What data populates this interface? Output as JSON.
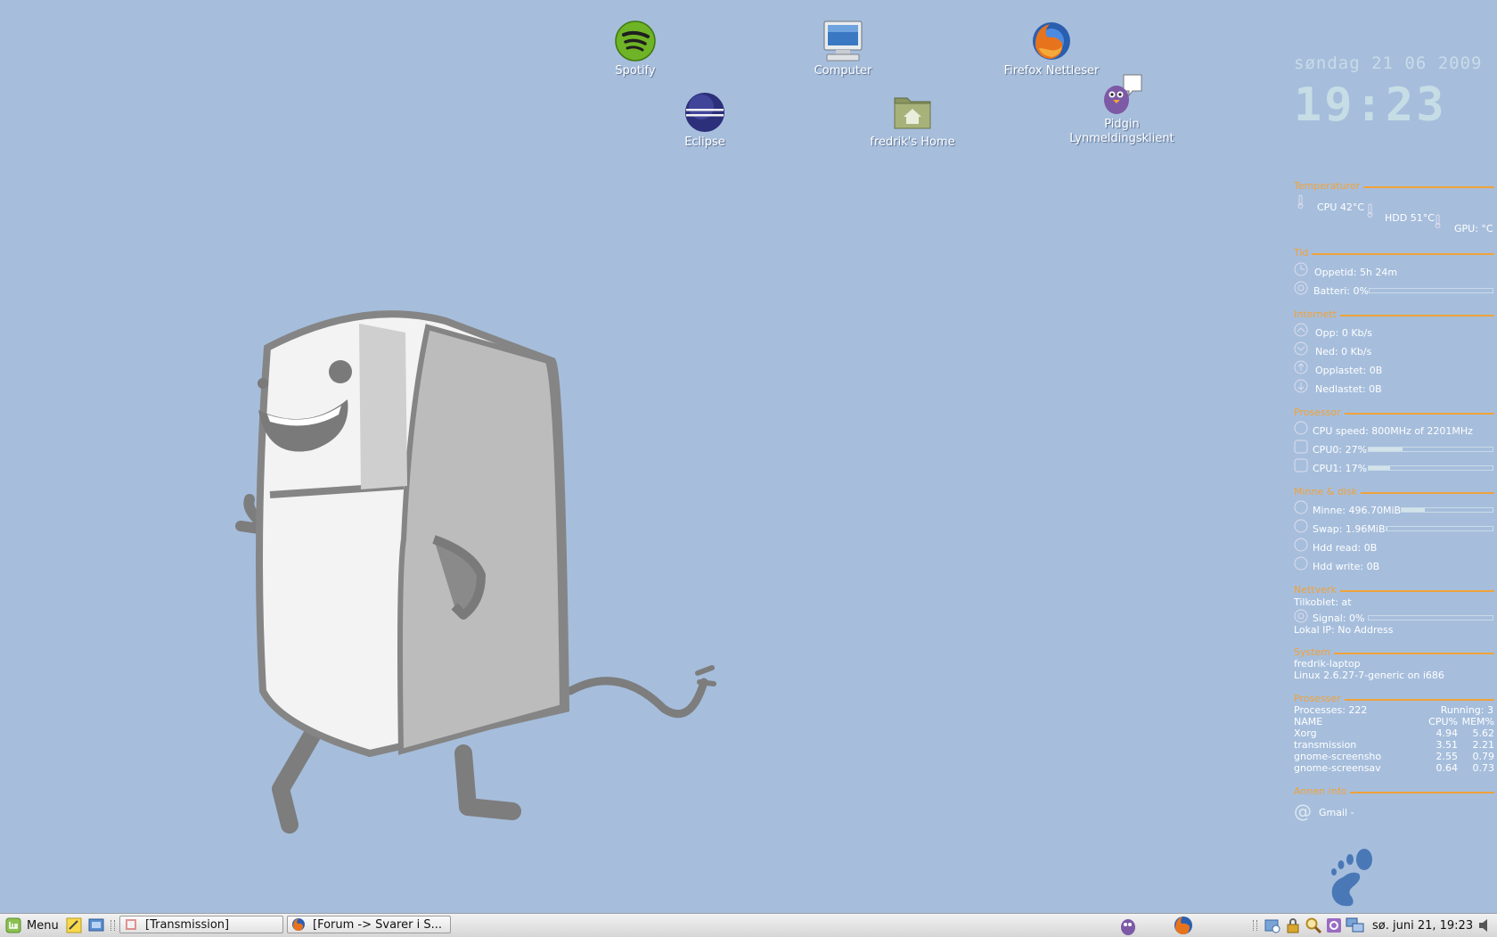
{
  "desktop_icons": [
    {
      "id": "spotify",
      "label": "Spotify",
      "icon": "spotify-icon"
    },
    {
      "id": "computer",
      "label": "Computer",
      "icon": "computer-icon"
    },
    {
      "id": "firefox",
      "label": "Firefox Nettleser",
      "icon": "firefox-icon"
    },
    {
      "id": "eclipse",
      "label": "Eclipse",
      "icon": "eclipse-icon"
    },
    {
      "id": "home",
      "label": "fredrik's Home",
      "icon": "home-folder-icon"
    },
    {
      "id": "pidgin",
      "label": "Pidgin\nLynmeldingsklient",
      "label_line1": "Pidgin",
      "label_line2": "Lynmeldingsklient",
      "icon": "pidgin-icon"
    }
  ],
  "conky": {
    "date": "søndag 21 06 2009",
    "time": "19:23",
    "temp": {
      "title": "Temperaturer",
      "cpu": "CPU 42°C",
      "hdd": "HDD 51°C",
      "gpu": "GPU: °C"
    },
    "tid": {
      "title": "Tid",
      "uptime": "Oppetid: 5h 24m",
      "battery": "Batteri: 0%",
      "battery_pct": 0
    },
    "internet": {
      "title": "Internett",
      "up": "Opp: 0 Kb/s",
      "down": "Ned: 0 Kb/s",
      "uploaded": "Opplastet: 0B",
      "downloaded": "Nedlastet: 0B"
    },
    "cpu": {
      "title": "Prosessor",
      "speed": "CPU speed: 800MHz of 2201MHz",
      "cpu0": "CPU0: 27%",
      "cpu0_pct": 27,
      "cpu1": "CPU1: 17%",
      "cpu1_pct": 17
    },
    "mem": {
      "title": "Minne & disk",
      "mem": "Minne: 496.70MiB",
      "mem_pct": 25,
      "swap": "Swap: 1.96MiB",
      "swap_pct": 1,
      "hdd_read": "Hdd read: 0B",
      "hdd_write": "Hdd write: 0B"
    },
    "net": {
      "title": "Nettverk",
      "connected": "Tilkoblet:  at",
      "signal": "Signal: 0%",
      "signal_pct": 0,
      "local_ip": "Lokal IP: No Address"
    },
    "system": {
      "title": "System",
      "host": "fredrik-laptop",
      "kernel": "Linux 2.6.27-7-generic on i686"
    },
    "proc": {
      "title": "Prosesser",
      "count": "Processes: 222",
      "running": "Running: 3",
      "header": {
        "name": "NAME",
        "cpu": "CPU%",
        "mem": "MEM%"
      },
      "rows": [
        {
          "name": "Xorg",
          "cpu": "4.94",
          "mem": "5.62"
        },
        {
          "name": "transmission",
          "cpu": "3.51",
          "mem": "2.21"
        },
        {
          "name": "gnome-screensho",
          "cpu": "2.55",
          "mem": "0.79"
        },
        {
          "name": "gnome-screensav",
          "cpu": "0.64",
          "mem": "0.73"
        }
      ]
    },
    "other": {
      "title": "Annen info",
      "gmail": "Gmail -"
    }
  },
  "taskbar": {
    "menu_label": "Menu",
    "tasks": [
      {
        "label": "[Transmission]"
      },
      {
        "label": "[Forum -> Svarer i S..."
      }
    ],
    "clock": "sø. juni 21, 19:23"
  },
  "colors": {
    "background": "#a6bedc",
    "conky_accent": "#f0a23a",
    "conky_text": "#ffffff"
  }
}
